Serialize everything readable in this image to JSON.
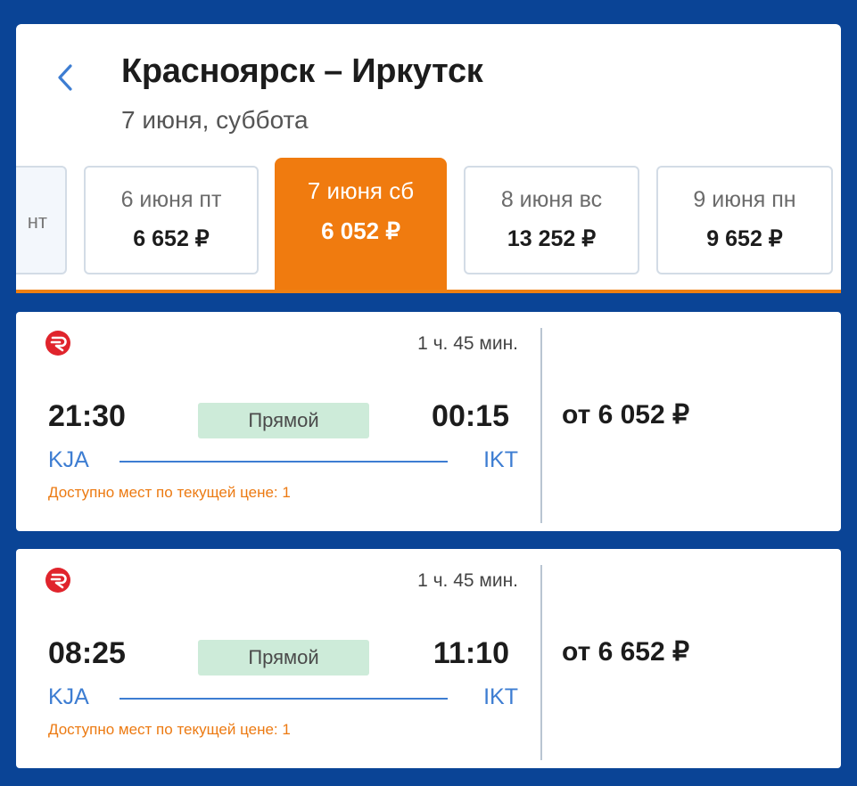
{
  "header": {
    "title": "Красноярск – Иркутск",
    "subtitle": "7 июня, суббота"
  },
  "date_tabs": [
    {
      "label": "нт",
      "price": ""
    },
    {
      "label": "6 июня пт",
      "price": "6 652 ₽"
    },
    {
      "label": "7 июня сб",
      "price": "6 052 ₽",
      "active": true
    },
    {
      "label": "8 июня вс",
      "price": "13 252 ₽"
    },
    {
      "label": "9 июня пн",
      "price": "9 652 ₽"
    }
  ],
  "flights": [
    {
      "duration": "1 ч. 45 мин.",
      "departure_time": "21:30",
      "arrival_time": "00:15",
      "badge": "Прямой",
      "from_code": "KJA",
      "to_code": "IKT",
      "seats_note": "Доступно мест по текущей цене: 1",
      "price": "от 6 052 ₽"
    },
    {
      "duration": "1 ч. 45 мин.",
      "departure_time": "08:25",
      "arrival_time": "11:10",
      "badge": "Прямой",
      "from_code": "KJA",
      "to_code": "IKT",
      "seats_note": "Доступно мест по текущей цене: 1",
      "price": "от 6 652 ₽"
    }
  ],
  "icons": {
    "back": "chevron-left-icon",
    "airline": "airline-logo-icon"
  },
  "colors": {
    "background": "#0a4496",
    "accent": "#f07b0f",
    "link": "#3d7dd2",
    "badge": "#cdebd9"
  }
}
